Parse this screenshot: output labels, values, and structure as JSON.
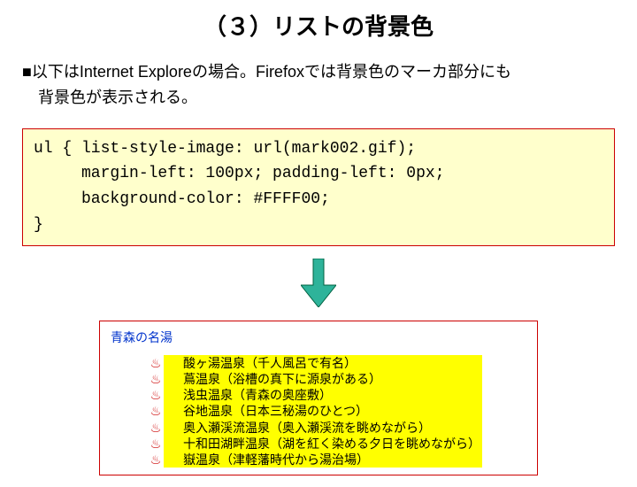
{
  "title": "（３）リストの背景色",
  "desc_line1": "■以下はInternet Exploreの場合。Firefoxでは背景色のマーカ部分にも",
  "desc_line2": "　背景色が表示される。",
  "code": {
    "l1": "ul { list-style-image: url(mark002.gif);",
    "l2": "     margin-left: 100px; padding-left: 0px;",
    "l3": "     background-color: #FFFF00;",
    "l4": "}"
  },
  "example": {
    "heading": "青森の名湯",
    "marker": "♨",
    "items": [
      "酸ヶ湯温泉（千人風呂で有名）",
      "蔦温泉（浴槽の真下に源泉がある）",
      "浅虫温泉（青森の奥座敷）",
      "谷地温泉（日本三秘湯のひとつ）",
      "奥入瀬渓流温泉（奥入瀬渓流を眺めながら）",
      "十和田湖畔温泉（湖を紅く染める夕日を眺めながら）",
      "嶽温泉（津軽藩時代から湯治場）"
    ]
  }
}
